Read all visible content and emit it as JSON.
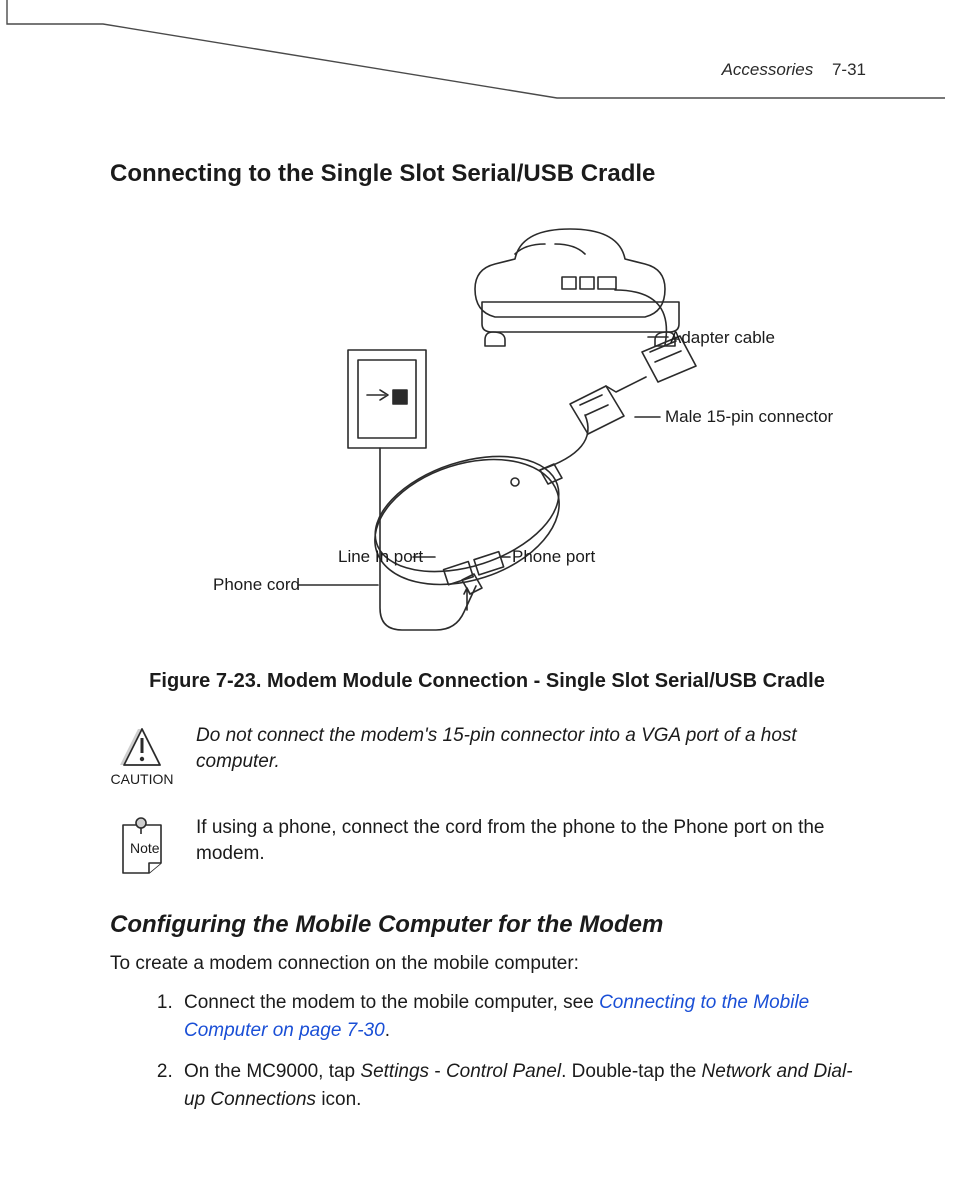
{
  "header": {
    "section": "Accessories",
    "page": "7-31"
  },
  "title1": "Connecting to the Single Slot Serial/USB Cradle",
  "figure": {
    "labels": {
      "adapter_cable": "Adapter cable",
      "male_15pin": "Male 15-pin connector",
      "phone_port": "Phone port",
      "line_in_port": "Line In port",
      "phone_cord": "Phone cord"
    },
    "caption_prefix": "Figure 7-23.  ",
    "caption": "Modem Module Connection - Single Slot Serial/USB Cradle"
  },
  "caution": {
    "label": "CAUTION",
    "text": "Do not connect the modem's 15-pin connector into a VGA port of a host computer."
  },
  "note": {
    "label": "Note",
    "text": "If using a phone, connect the cord from the phone to the Phone port on the modem."
  },
  "title2": "Configuring the Mobile Computer for the Modem",
  "lead": "To create a modem connection on the mobile computer:",
  "steps": {
    "s1a": "Connect the modem to the mobile computer, see ",
    "s1link": "Connecting to the Mobile Computer on page 7-30",
    "s1b": ".",
    "s2a": "On the MC9000, tap ",
    "s2ui1": "Settings",
    "s2dash": " - ",
    "s2ui2": "Control Panel",
    "s2mid": ". Double-tap the ",
    "s2ui3": "Network and Dial-up Connections",
    "s2end": " icon."
  }
}
